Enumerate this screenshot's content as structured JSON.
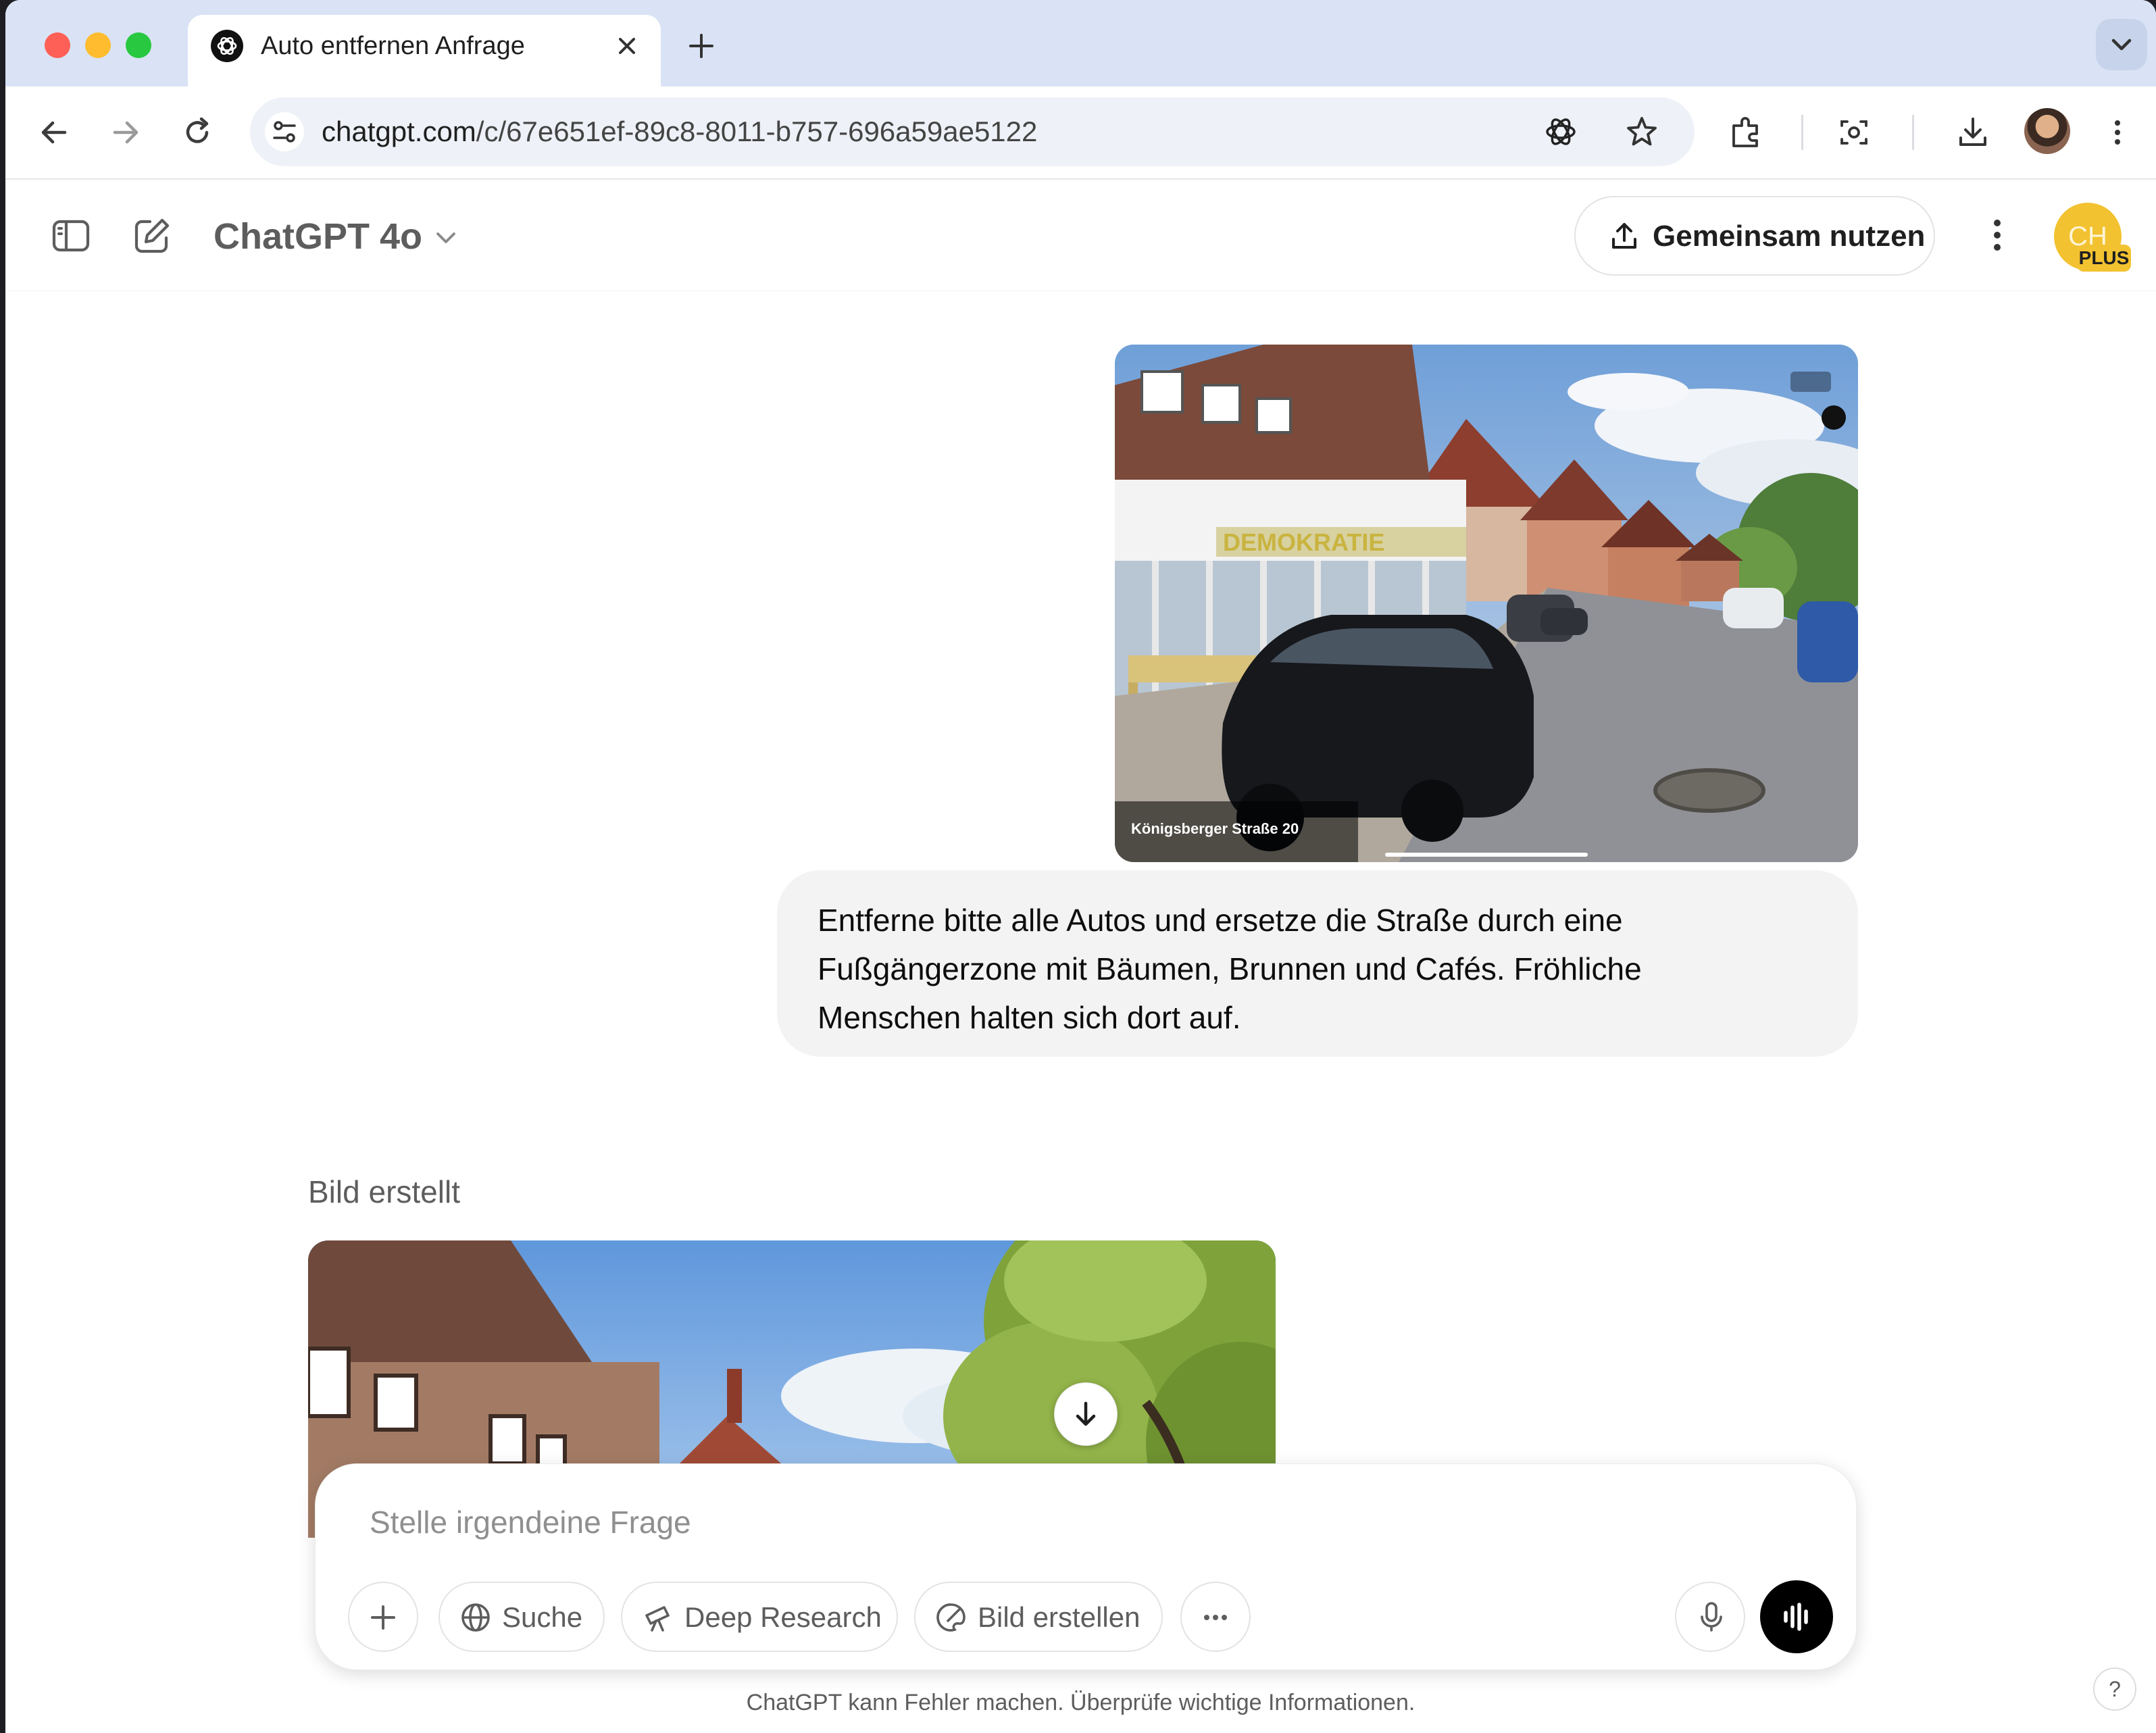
{
  "browser": {
    "tab_title": "Auto entfernen Anfrage",
    "url_host": "chatgpt.com",
    "url_path": "/c/67e651ef-89c8-8011-b757-696a59ae5122",
    "traffic_lights": {
      "close": "#fe5f57",
      "minimize": "#febc2e",
      "zoom": "#28c840"
    },
    "icons": [
      "back-icon",
      "forward-icon",
      "reload-icon",
      "site-settings-icon",
      "chatgpt-extension-icon",
      "star-icon",
      "extensions-icon",
      "screenshot-lens-icon",
      "download-icon",
      "profile-avatar",
      "kebab-menu-icon"
    ]
  },
  "header": {
    "model_name": "ChatGPT 4o",
    "share_label": "Gemeinsam nutzen",
    "avatar_initials": "CH",
    "plan_badge": "PLUS",
    "accent": "#f2c230"
  },
  "conversation": {
    "user_image": {
      "street_label": "Königsberger Straße 20",
      "storefront_sign": "DEMOKRATIE"
    },
    "user_message": "Entferne bitte alle Autos und ersetze die Straße durch eine Fußgängerzone mit Bäumen, Brunnen und Cafés. Fröhliche Menschen halten sich dort auf.",
    "assistant_status": "Bild erstellt"
  },
  "composer": {
    "placeholder": "Stelle irgendeine Frage",
    "value": "",
    "tools": {
      "search": "Suche",
      "deep_research": "Deep Research",
      "create_image": "Bild erstellen"
    }
  },
  "footer": {
    "disclaimer": "ChatGPT kann Fehler machen. Überprüfe wichtige Informationen.",
    "help": "?"
  }
}
